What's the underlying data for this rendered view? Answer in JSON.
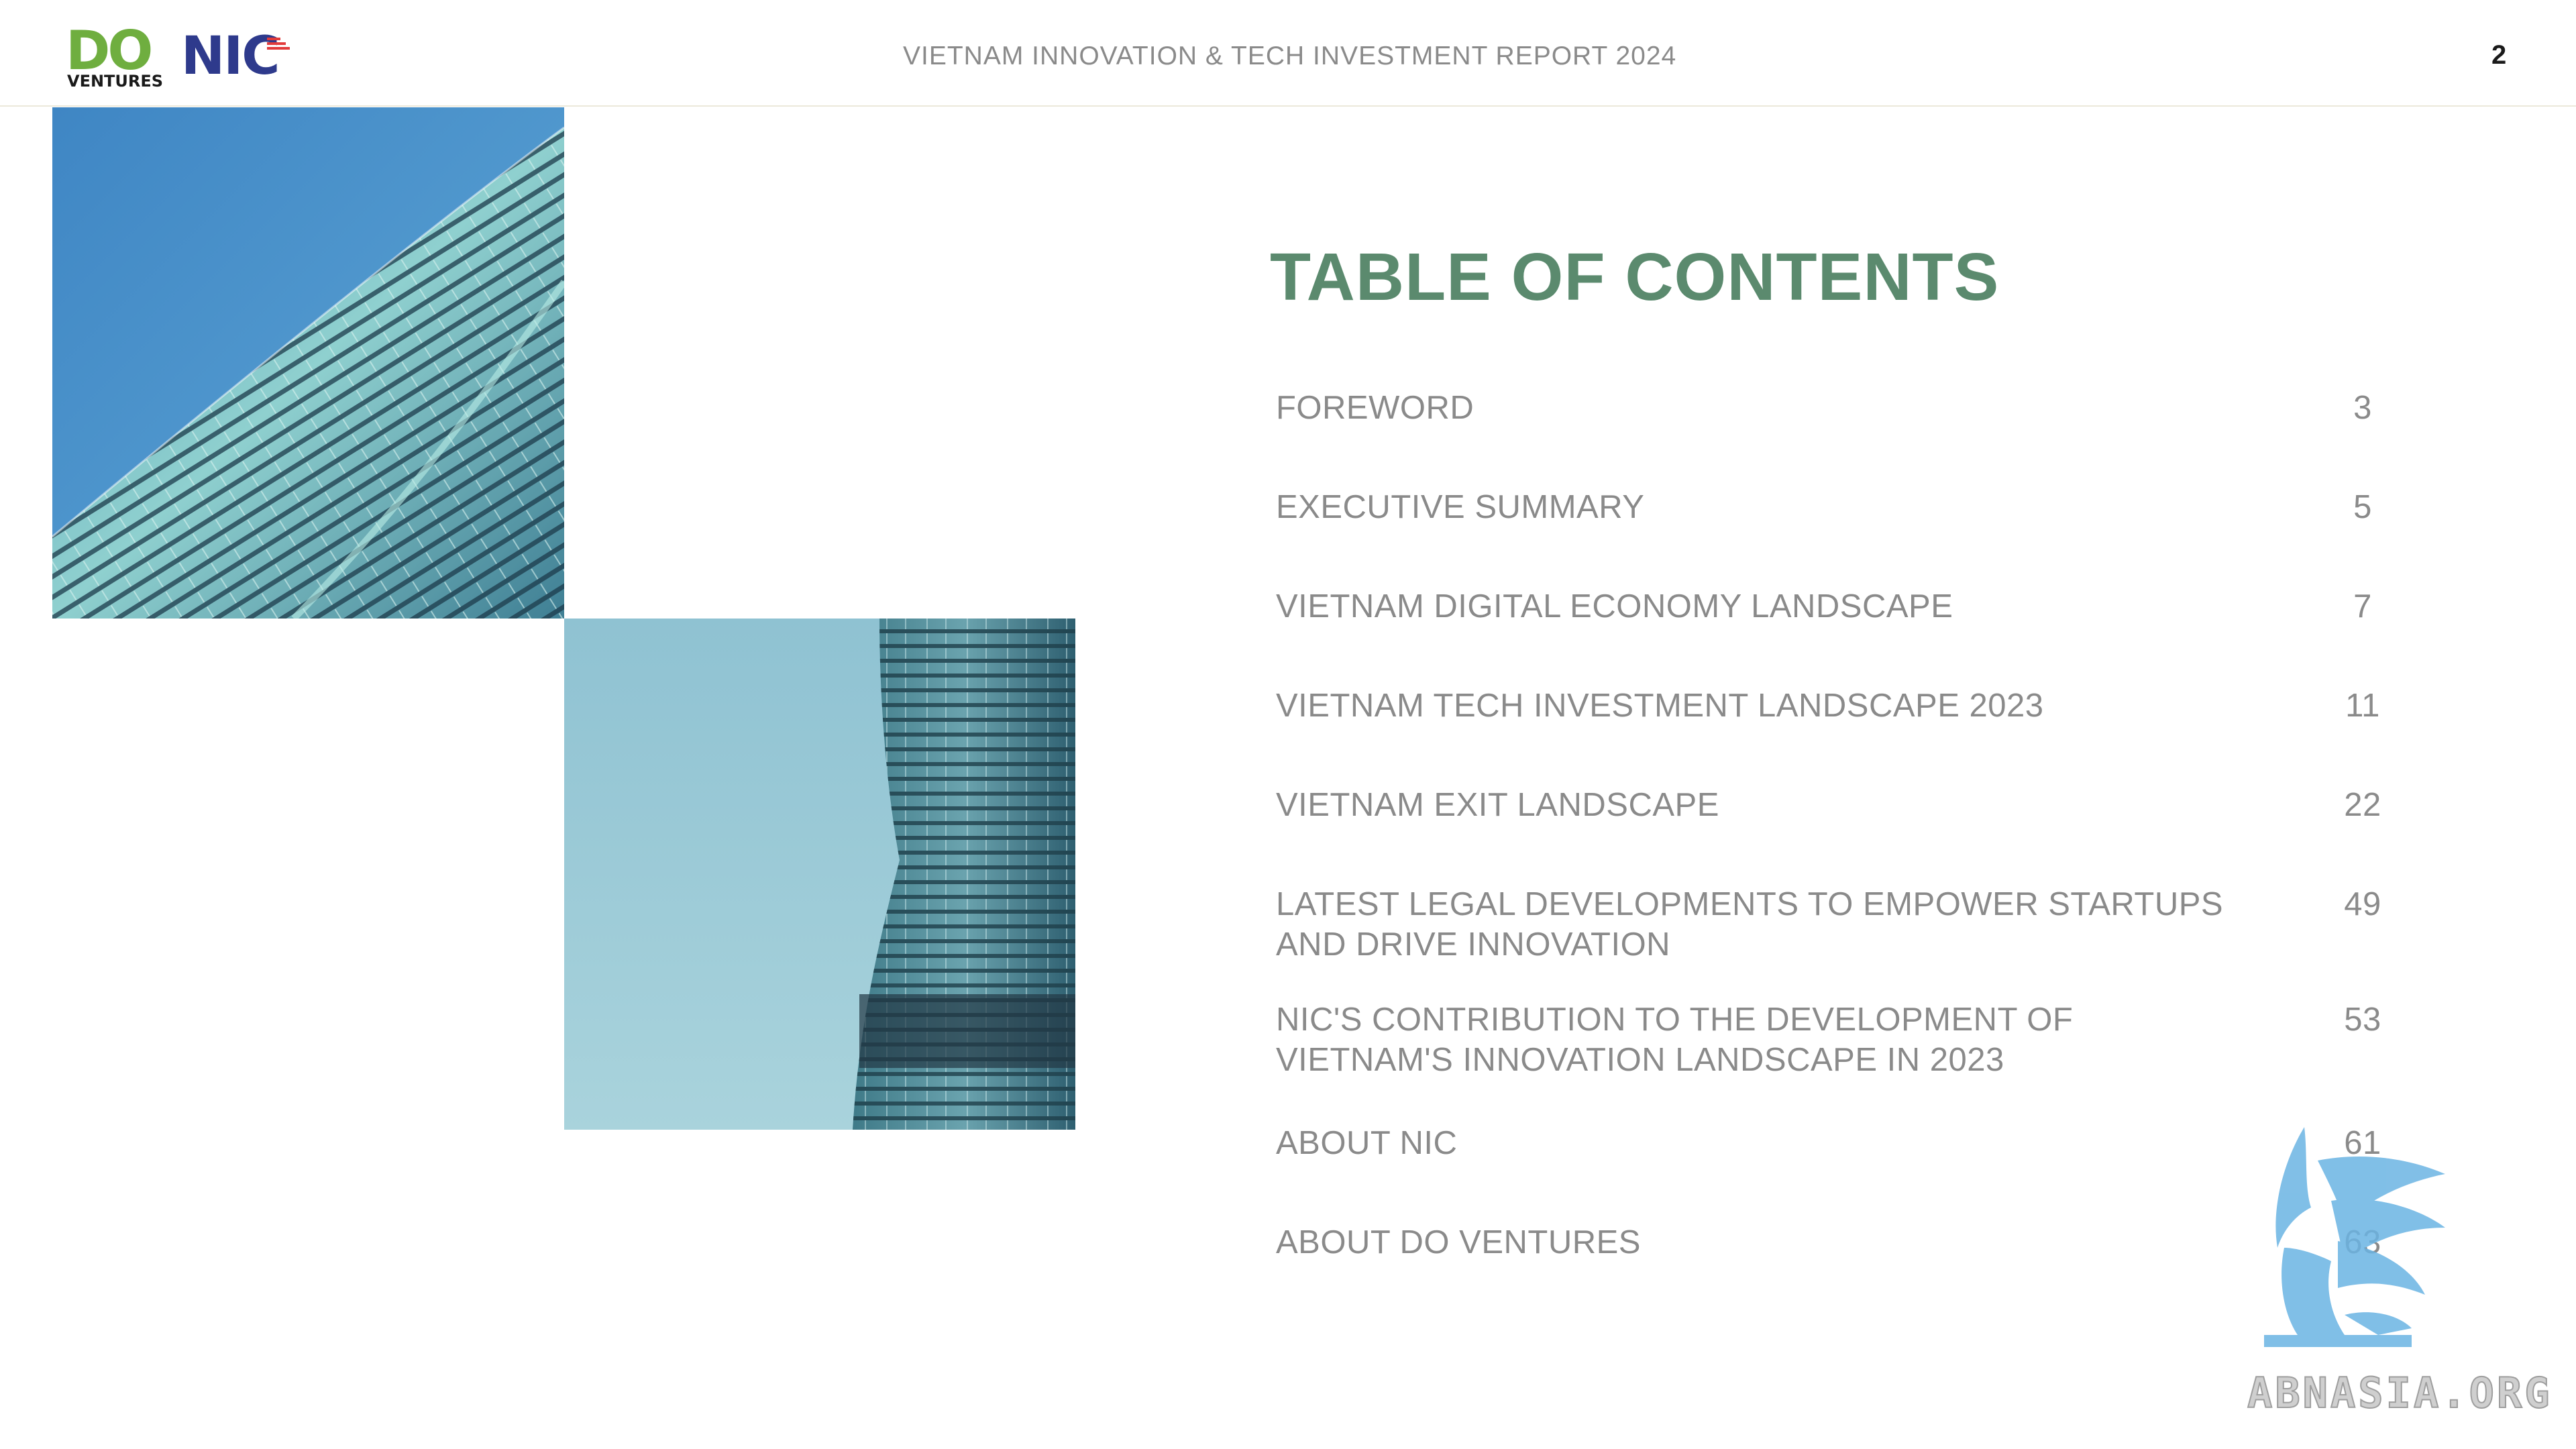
{
  "header": {
    "logo_do": "DO",
    "logo_ventures": "VENTURES",
    "logo_nic": "NIC",
    "title": "VIETNAM INNOVATION & TECH INVESTMENT REPORT 2024",
    "page_number": "2"
  },
  "toc": {
    "title": "TABLE OF CONTENTS",
    "items": [
      {
        "label": "FOREWORD",
        "page": "3"
      },
      {
        "label": "EXECUTIVE SUMMARY",
        "page": "5"
      },
      {
        "label": "VIETNAM DIGITAL ECONOMY LANDSCAPE",
        "page": "7"
      },
      {
        "label": "VIETNAM TECH INVESTMENT LANDSCAPE 2023",
        "page": "11"
      },
      {
        "label": "VIETNAM EXIT LANDSCAPE",
        "page": "22"
      },
      {
        "label": "LATEST LEGAL DEVELOPMENTS TO EMPOWER STARTUPS AND DRIVE INNOVATION",
        "page": "49"
      },
      {
        "label": "NIC'S CONTRIBUTION TO THE DEVELOPMENT OF VIETNAM'S INNOVATION LANDSCAPE IN 2023",
        "page": "53"
      },
      {
        "label": "ABOUT NIC",
        "page": "61"
      },
      {
        "label": "ABOUT DO VENTURES",
        "page": "63"
      }
    ]
  },
  "watermark": {
    "text": "ABNASIA.ORG",
    "icon": "griffin-icon"
  },
  "colors": {
    "title_green": "#5b8a6e",
    "logo_green": "#6fae3f",
    "logo_blue": "#2e3a8c",
    "text_gray": "#8a8a8a",
    "watermark_blue": "#6bb4e3"
  }
}
